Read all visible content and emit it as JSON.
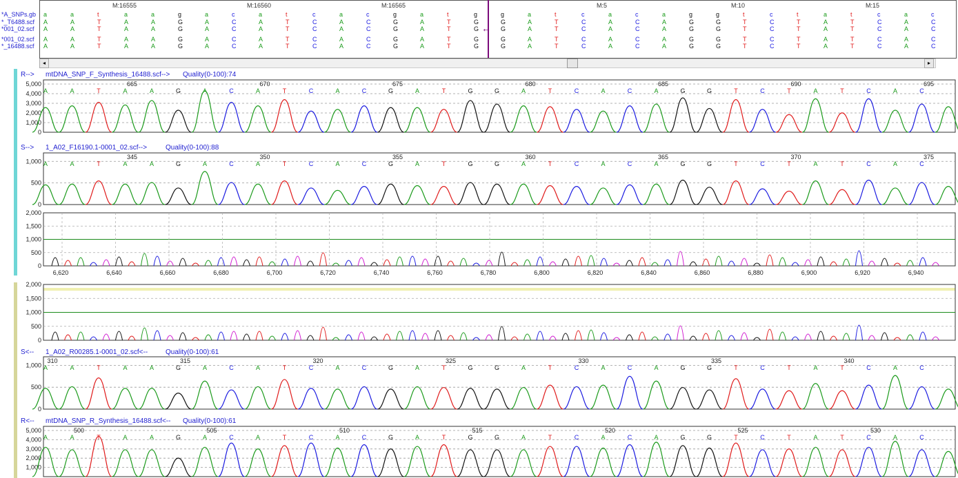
{
  "alignment": {
    "ruler_marks": [
      "M:16555",
      "M:16560",
      "M:16565",
      "M:5",
      "M:10",
      "M:15"
    ],
    "row_names": [
      "*A_SNPs.gb",
      "*_T6488.scf",
      "*001_02.scf",
      "*001_02.scf",
      "*_16488.scf"
    ],
    "rows": [
      [
        "a",
        "a",
        "t",
        "a",
        "a",
        "g",
        "a",
        "c",
        "a",
        "t",
        "c",
        "a",
        "c",
        "g",
        "a",
        "t",
        "g",
        "g",
        "a",
        "t",
        "c",
        "a",
        "c",
        "a",
        "g",
        "g",
        "t",
        "c",
        "t",
        "a",
        "t",
        "c",
        "a",
        "c"
      ],
      [
        "A",
        "A",
        "T",
        "A",
        "A",
        "G",
        "A",
        "C",
        "A",
        "T",
        "C",
        "A",
        "C",
        "G",
        "A",
        "T",
        "G",
        "G",
        "A",
        "T",
        "C",
        "A",
        "C",
        "A",
        "G",
        "G",
        "T",
        "C",
        "T",
        "A",
        "T",
        "C",
        "A",
        "C"
      ],
      [
        "A",
        "A",
        "T",
        "A",
        "A",
        "G",
        "A",
        "C",
        "A",
        "T",
        "C",
        "A",
        "C",
        "G",
        "A",
        "T",
        "G",
        "G",
        "A",
        "T",
        "C",
        "A",
        "C",
        "A",
        "G",
        "G",
        "T",
        "C",
        "T",
        "A",
        "T",
        "C",
        "A",
        "C"
      ],
      [
        "A",
        "A",
        "T",
        "A",
        "A",
        "G",
        "A",
        "C",
        "A",
        "T",
        "C",
        "A",
        "C",
        "G",
        "A",
        "T",
        "G",
        "G",
        "A",
        "T",
        "C",
        "A",
        "C",
        "A",
        "G",
        "G",
        "T",
        "C",
        "T",
        "A",
        "T",
        "C",
        "A",
        "C"
      ],
      [
        "A",
        "A",
        "T",
        "A",
        "A",
        "G",
        "A",
        "C",
        "A",
        "T",
        "C",
        "A",
        "C",
        "G",
        "A",
        "T",
        "G",
        "G",
        "A",
        "T",
        "C",
        "A",
        "C",
        "A",
        "G",
        "G",
        "T",
        "C",
        "T",
        "A",
        "T",
        "C",
        "A",
        "C"
      ]
    ],
    "scroll_left_glyph": "◂",
    "scroll_right_glyph": "▸"
  },
  "colors": {
    "A": "#1a9a1a",
    "T": "#e01a1a",
    "C": "#1a1ae0",
    "G": "#111111",
    "teal_bar": "#6fd6d6",
    "olive_bar": "#d6d69a",
    "cursor": "#7a0a7a"
  },
  "bases": [
    "A",
    "A",
    "T",
    "A",
    "A",
    "G",
    "A",
    "C",
    "A",
    "T",
    "C",
    "A",
    "C",
    "G",
    "A",
    "T",
    "G",
    "G",
    "A",
    "T",
    "C",
    "A",
    "C",
    "A",
    "G",
    "G",
    "T",
    "C",
    "T",
    "A",
    "T",
    "C",
    "A",
    "C"
  ],
  "traces": [
    {
      "header_dir": "R-->",
      "name": "mtDNA_SNP_F_Synthesis_16488.scf-->",
      "quality": "Quality(0-100):74",
      "y_ticks": [
        "5,000",
        "4,000",
        "3,000",
        "2,000",
        "1,000",
        "0"
      ],
      "ymax": 5000,
      "positions": [
        {
          "label": "665",
          "index": 3
        },
        {
          "label": "670",
          "index": 8
        },
        {
          "label": "675",
          "index": 13
        },
        {
          "label": "680",
          "index": 18
        },
        {
          "label": "685",
          "index": 23
        },
        {
          "label": "690",
          "index": 28
        },
        {
          "label": "695",
          "index": 33
        }
      ],
      "peaks": [
        2800,
        3000,
        3400,
        3100,
        3600,
        2500,
        4700,
        3400,
        3000,
        3700,
        2400,
        2600,
        3000,
        2800,
        2800,
        2600,
        3600,
        3200,
        3000,
        2900,
        2600,
        2400,
        3000,
        3200,
        3900,
        2700,
        3700,
        2600,
        2000,
        3800,
        2200,
        3800,
        2500,
        3200,
        2900
      ]
    },
    {
      "header_dir": "S-->",
      "name": "1_A02_F16190.1-0001_02.scf-->",
      "quality": "Quality(0-100):88",
      "y_ticks": [
        "1,000",
        "500",
        "0"
      ],
      "ymax": 1100,
      "positions": [
        {
          "label": "345",
          "index": 3
        },
        {
          "label": "350",
          "index": 8
        },
        {
          "label": "355",
          "index": 13
        },
        {
          "label": "360",
          "index": 18
        },
        {
          "label": "365",
          "index": 23
        },
        {
          "label": "370",
          "index": 28
        },
        {
          "label": "375",
          "index": 33
        }
      ],
      "peaks": [
        500,
        520,
        600,
        520,
        560,
        420,
        840,
        560,
        520,
        600,
        420,
        360,
        460,
        520,
        480,
        460,
        560,
        520,
        520,
        480,
        460,
        420,
        500,
        520,
        620,
        440,
        600,
        400,
        340,
        600,
        380,
        620,
        420,
        560,
        460
      ]
    },
    {
      "header_dir": "S<--",
      "name": "1_A02_R00285.1-0001_02.scf<--",
      "quality": "Quality(0-100):61",
      "y_ticks": [
        "1,000",
        "500",
        "0"
      ],
      "ymax": 1100,
      "positions": [
        {
          "label": "310",
          "index": 0
        },
        {
          "label": "315",
          "index": 5
        },
        {
          "label": "320",
          "index": 10
        },
        {
          "label": "325",
          "index": 15
        },
        {
          "label": "330",
          "index": 20
        },
        {
          "label": "335",
          "index": 25
        },
        {
          "label": "340",
          "index": 30
        }
      ],
      "peaks": [
        520,
        560,
        780,
        520,
        520,
        400,
        700,
        480,
        560,
        740,
        520,
        500,
        560,
        500,
        560,
        540,
        520,
        500,
        540,
        600,
        560,
        600,
        820,
        700,
        540,
        480,
        760,
        500,
        460,
        640,
        460,
        600,
        840,
        560,
        500
      ]
    },
    {
      "header_dir": "R<--",
      "name": "mtDNA_SNP_R_Synthesis_16488.scf<--",
      "quality": "Quality(0-100):61",
      "y_ticks": [
        "5,000",
        "4,000",
        "3,000",
        "2,000",
        "1,000"
      ],
      "ymax": 5000,
      "positions": [
        {
          "label": "500",
          "index": 1
        },
        {
          "label": "505",
          "index": 6
        },
        {
          "label": "510",
          "index": 11
        },
        {
          "label": "515",
          "index": 16
        },
        {
          "label": "520",
          "index": 21
        },
        {
          "label": "525",
          "index": 26
        },
        {
          "label": "530",
          "index": 31
        }
      ],
      "peaks": [
        3500,
        3200,
        4800,
        3200,
        3200,
        2200,
        3500,
        4000,
        3300,
        3700,
        4000,
        3400,
        3800,
        3300,
        3600,
        3800,
        3200,
        3200,
        3200,
        3600,
        3600,
        3400,
        3800,
        4100,
        3700,
        3400,
        4000,
        3200,
        3300,
        3500,
        3200,
        3500,
        4200,
        3200,
        3000
      ]
    }
  ],
  "difference_plot_top": {
    "y_ticks": [
      "2,000",
      "1,500",
      "1,000",
      "500",
      "0"
    ],
    "x_ticks": [
      "6,620",
      "6,640",
      "6,660",
      "6,680",
      "6,700",
      "6,720",
      "6,740",
      "6,760",
      "6,780",
      "6,800",
      "6,820",
      "6,840",
      "6,860",
      "6,880",
      "6,900",
      "6,920",
      "6,940"
    ]
  },
  "difference_plot_bottom": {
    "y_ticks": [
      "2,000",
      "1,500",
      "1,000",
      "500",
      "0"
    ]
  }
}
